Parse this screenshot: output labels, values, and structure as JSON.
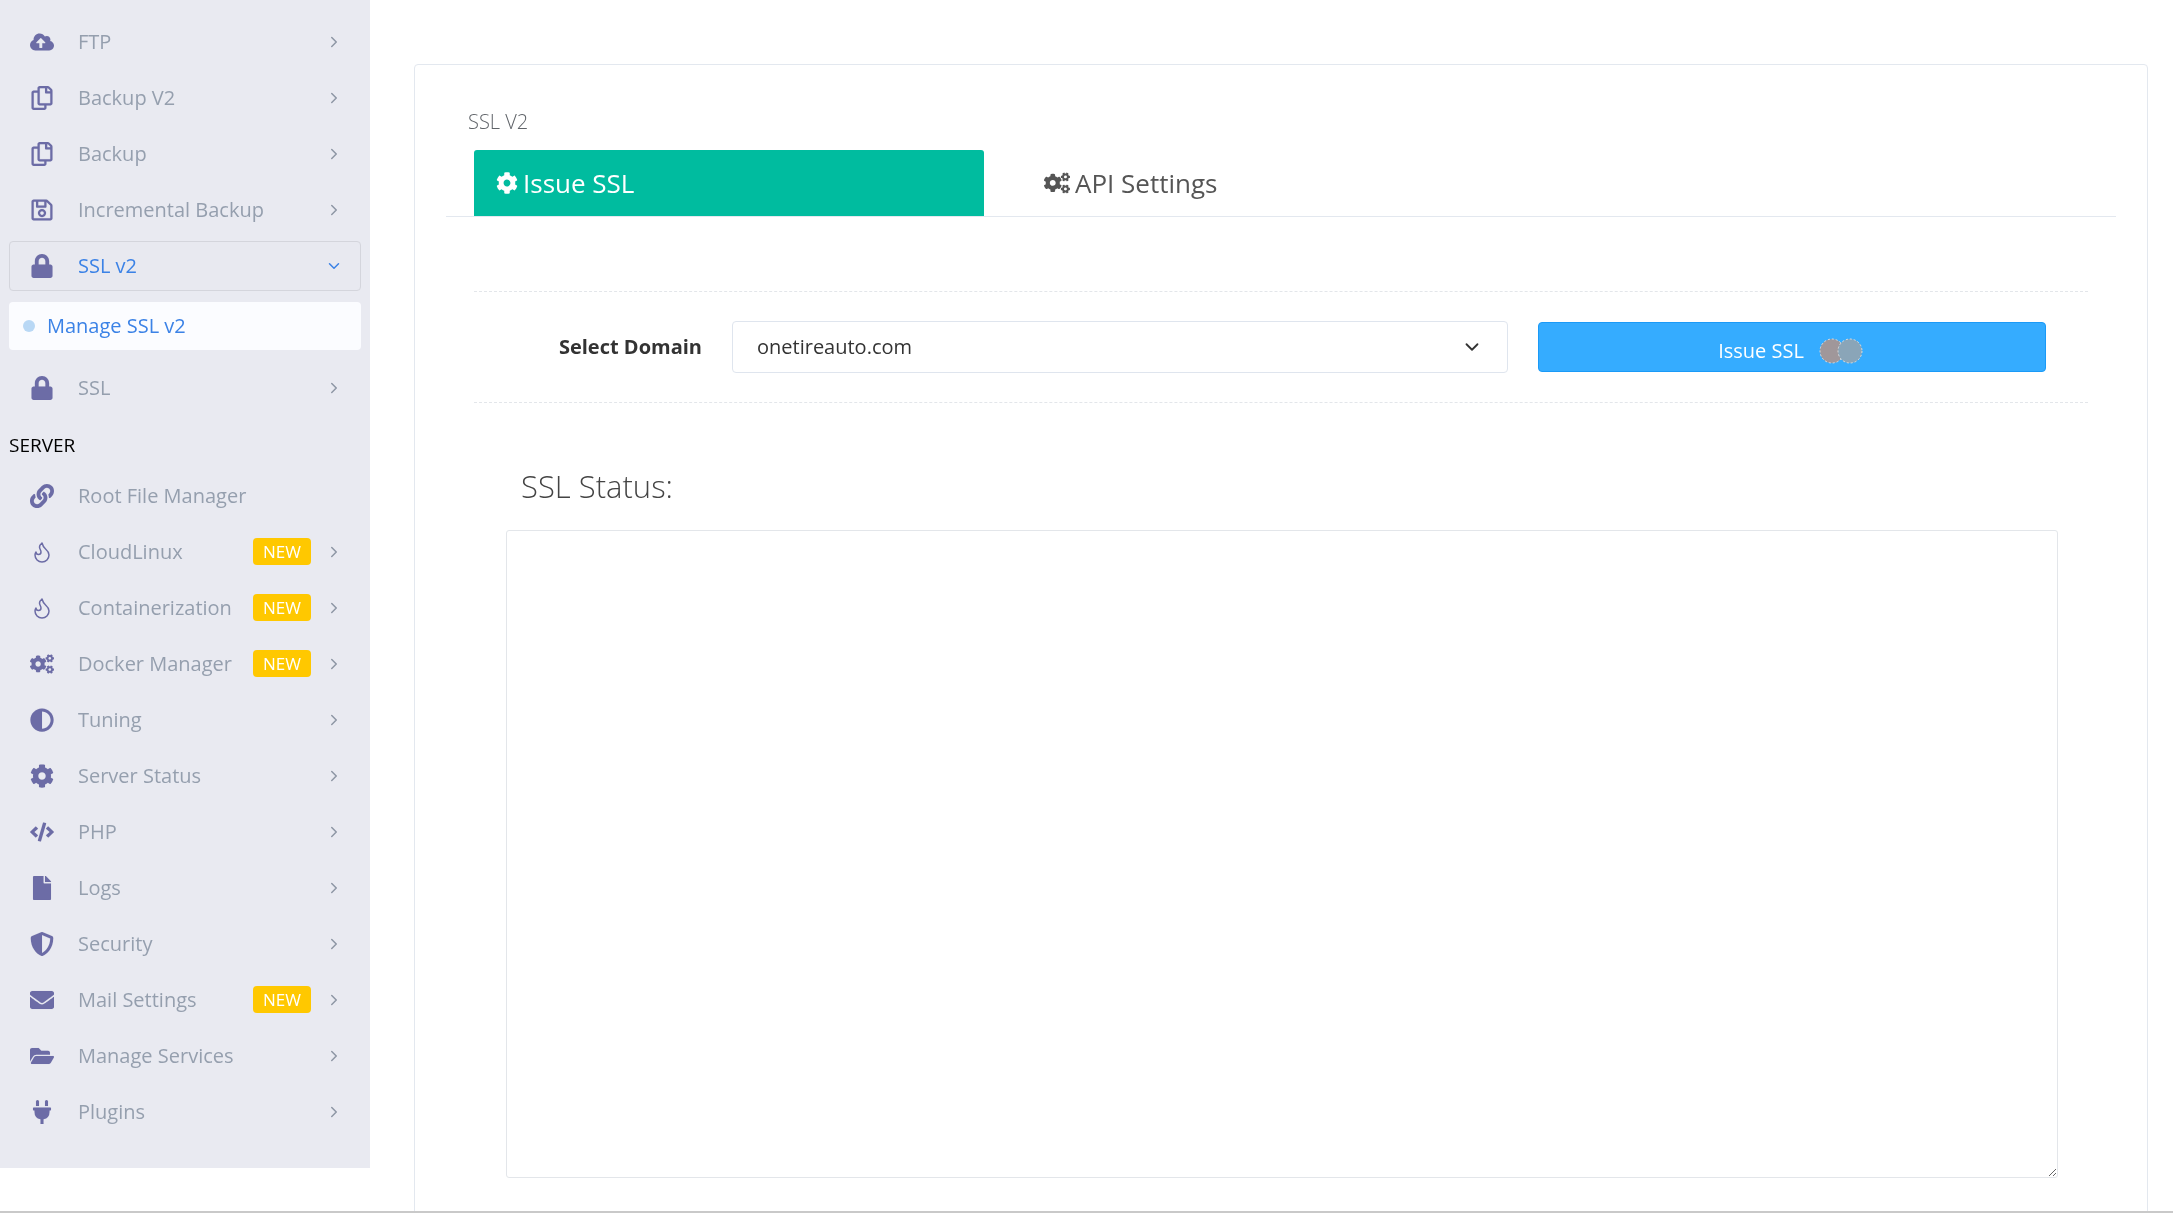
{
  "sidebar": {
    "groups": [
      {
        "items": [
          {
            "label": "FTP",
            "expanded": false
          },
          {
            "label": "Backup V2",
            "expanded": false
          },
          {
            "label": "Backup",
            "expanded": false
          },
          {
            "label": "Incremental Backup",
            "expanded": false
          },
          {
            "label": "SSL v2",
            "expanded": true,
            "children": [
              {
                "label": "Manage SSL v2",
                "selected": true
              }
            ]
          },
          {
            "label": "SSL",
            "expanded": false
          }
        ]
      },
      {
        "heading": "SERVER",
        "items": [
          {
            "label": "Root File Manager"
          },
          {
            "label": "CloudLinux",
            "badge": "NEW",
            "expanded": false
          },
          {
            "label": "Containerization",
            "badge": "NEW",
            "expanded": false
          },
          {
            "label": "Docker Manager",
            "badge": "NEW",
            "expanded": false
          },
          {
            "label": "Tuning",
            "expanded": false
          },
          {
            "label": "Server Status",
            "expanded": false
          },
          {
            "label": "PHP",
            "expanded": false
          },
          {
            "label": "Logs",
            "expanded": false
          },
          {
            "label": "Security",
            "expanded": false
          },
          {
            "label": "Mail Settings",
            "badge": "NEW",
            "expanded": false
          },
          {
            "label": "Manage Services",
            "expanded": false
          },
          {
            "label": "Plugins",
            "expanded": false
          }
        ]
      }
    ]
  },
  "panel": {
    "title": "SSL V2",
    "tabs": [
      {
        "label": "Issue SSL",
        "selected": true
      },
      {
        "label": "API Settings",
        "selected": false
      }
    ],
    "domain_label": "Select Domain",
    "domain_value": "onetireauto.com",
    "issue_button": {
      "label": "Issue SSL",
      "loading": true
    },
    "status_title": "SSL Status:"
  }
}
